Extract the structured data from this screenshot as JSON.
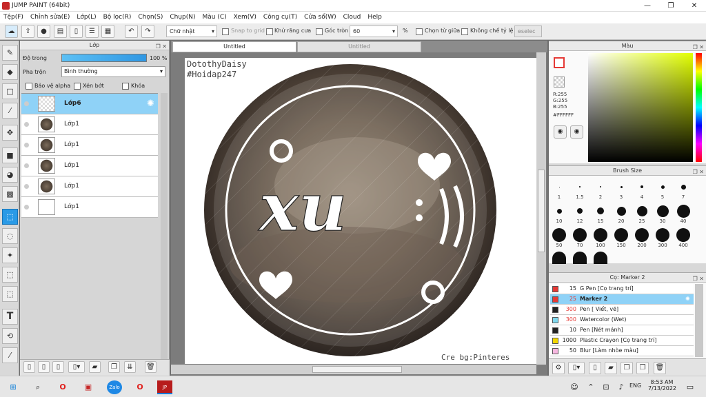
{
  "window": {
    "title": "JUMP PAINT (64bit)"
  },
  "menu": [
    "Tệp(F)",
    "Chỉnh sửa(E)",
    "Lớp(L)",
    "Bộ lọc(R)",
    "Chọn(S)",
    "Chụp(N)",
    "Màu (C)",
    "Xem(V)",
    "Công cụ(T)",
    "Cửa sổ(W)",
    "Cloud",
    "Help"
  ],
  "toolbar": {
    "shape_select": "Chữ nhật",
    "snap_label": "Snap to grid",
    "antialias_label": "Khử răng cưa",
    "round_label": "Góc tròn",
    "round_value": "60",
    "percent": "%",
    "center_label": "Chọn từ giữa",
    "noscale_label": "Không chế tỷ lệ",
    "deselect_label": "eselec"
  },
  "layers_panel": {
    "title": "Lớp",
    "opacity_label": "Độ trong",
    "opacity_value": "100 %",
    "blend_label": "Pha trộn",
    "blend_value": "Bình thường",
    "protect_alpha": "Bảo vệ alpha",
    "clip": "Xén bớt",
    "lock": "Khóa",
    "layers": [
      {
        "name": "Lớp6",
        "selected": true
      },
      {
        "name": "Lớp1"
      },
      {
        "name": "Lớp1"
      },
      {
        "name": "Lớp1"
      },
      {
        "name": "Lớp1"
      },
      {
        "name": "Lớp1"
      }
    ]
  },
  "canvas": {
    "tab_active": "Untitled",
    "tab_inactive": "Untitled",
    "watermark_line1": "DotothyDaisy",
    "watermark_line2": "#Hoidap247",
    "credit": "Cre bg:Pinteres",
    "art_text": "xu"
  },
  "color_panel": {
    "title": "Màu",
    "r": "R:255",
    "g": "G:255",
    "b": "B:255",
    "hex": "#FFFFFF",
    "current_color": "#ffffff"
  },
  "brush_size_panel": {
    "title": "Brush Size",
    "sizes": [
      "1",
      "1.5",
      "2",
      "3",
      "4",
      "5",
      "7",
      "10",
      "12",
      "15",
      "20",
      "25",
      "30",
      "40",
      "50",
      "70",
      "100",
      "150",
      "200",
      "300",
      "400"
    ]
  },
  "brush_panel": {
    "title": "Cọ: Marker 2",
    "brushes": [
      {
        "size": "15",
        "name": "G Pen [Cọ trang trí]",
        "color": "#e53935"
      },
      {
        "size": "25",
        "name": "Marker 2",
        "color": "#e53935",
        "selected": true
      },
      {
        "size": "300",
        "name": "Pen [ Viết, vẽ]",
        "color": "#222222"
      },
      {
        "size": "300",
        "name": "Watercolor (Wet)",
        "color": "#7fd8ee"
      },
      {
        "size": "10",
        "name": "Pen [Nét mảnh]",
        "color": "#222222"
      },
      {
        "size": "1000",
        "name": "Plastic Crayon [Cọ trang trí]",
        "color": "#f2d600"
      },
      {
        "size": "50",
        "name": "Blur [Làm nhòe màu]",
        "color": "#f7b7e0"
      }
    ]
  },
  "taskbar": {
    "time": "8:53 AM",
    "date": "7/13/2022",
    "lang": "ENG"
  }
}
